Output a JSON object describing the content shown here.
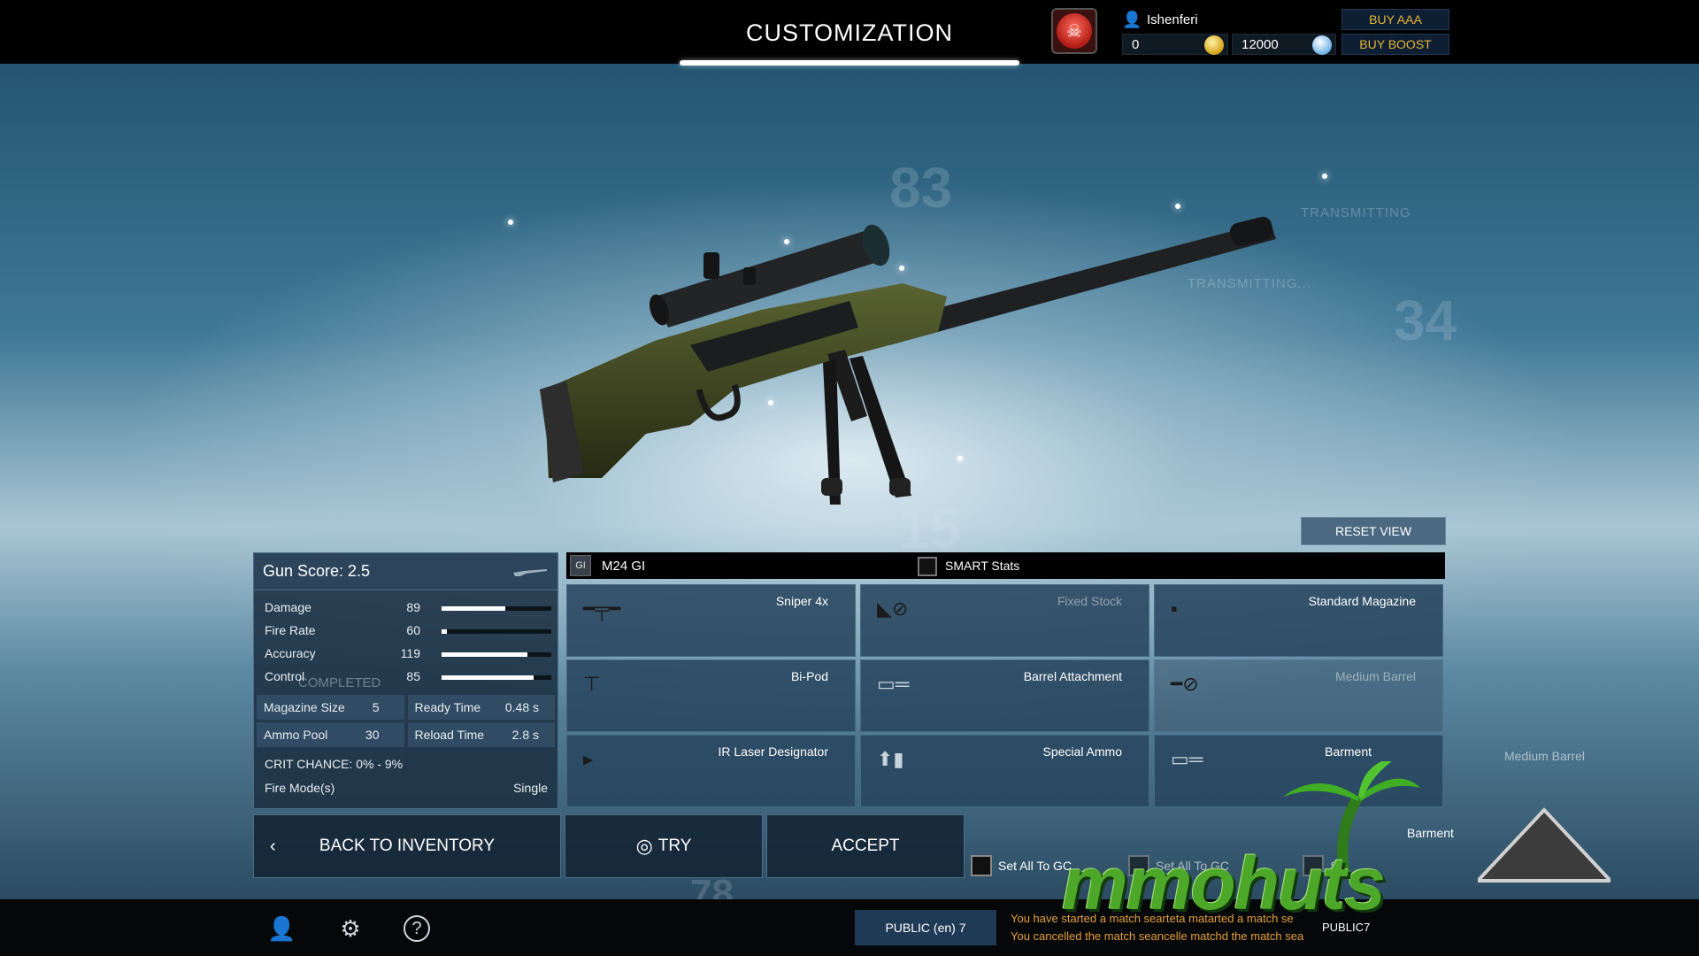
{
  "header": {
    "title": "CUSTOMIZATION",
    "username": "Ishenferi",
    "gold": "0",
    "cash": "12000",
    "buy_aaa": "BUY AAA",
    "buy_boost": "BUY BOOST"
  },
  "background": {
    "numbers": [
      "83",
      "34",
      "15",
      "78"
    ],
    "transmitting": [
      "TRANSMITTING",
      "TRANSMITTING..."
    ]
  },
  "reset_view": "RESET VIEW",
  "stats": {
    "gun_score": "Gun Score: 2.5",
    "rows": [
      {
        "label": "Damage",
        "value": "89",
        "fill": 0.58
      },
      {
        "label": "Fire Rate",
        "value": "60",
        "fill": 0.05
      },
      {
        "label": "Accuracy",
        "value": "119",
        "fill": 0.78
      },
      {
        "label": "Control",
        "value": "85",
        "fill": 0.84
      }
    ],
    "completed": "COMPLETED",
    "magazine_size": {
      "label": "Magazine Size",
      "value": "5"
    },
    "ready_time": {
      "label": "Ready Time",
      "value": "0.48 s"
    },
    "ammo_pool": {
      "label": "Ammo Pool",
      "value": "30"
    },
    "reload_time": {
      "label": "Reload Time",
      "value": "2.8 s"
    },
    "crit_chance": "CRIT CHANCE: 0% - 9%",
    "fire_modes_label": "Fire Mode(s)",
    "fire_modes_value": "Single"
  },
  "weapon": {
    "badge": "GI",
    "name": "M24 GI",
    "smart_stats": "SMART Stats"
  },
  "attachments": [
    {
      "label": "Sniper 4x",
      "icon": "scope-icon"
    },
    {
      "label": "Fixed Stock",
      "icon": "stock-icon"
    },
    {
      "label": "Standard Magazine",
      "icon": "magazine-icon"
    },
    {
      "label": "Bi-Pod",
      "icon": "bipod-icon"
    },
    {
      "label": "Barrel Attachment",
      "icon": "barrel-attachment-icon"
    },
    {
      "label": "Medium Barrel",
      "icon": "barrel-icon"
    },
    {
      "label": "IR Laser Designator",
      "icon": "laser-icon"
    },
    {
      "label": "Special Ammo",
      "icon": "ammo-icon"
    },
    {
      "label": "Barment",
      "icon": "barrel-attachment-icon"
    }
  ],
  "ghost_labels": {
    "medium_barrel": "Medium Barrel",
    "barment": "Barment"
  },
  "buttons": {
    "back": "BACK TO INVENTORY",
    "try": "TRY",
    "accept": "ACCEPT",
    "set_all_gc": "Set All To GC",
    "set_all_gc_2": "Set All To GC",
    "set_all_gc_3": "S"
  },
  "footer": {
    "lobby": "PUBLIC (en) 7",
    "lobby_ghost": "PUBLIC7",
    "chat": [
      "You have started a match searteta matarted a match se",
      "You cancelled the match seancelle matchd the match sea"
    ]
  },
  "watermark": "mmohuts",
  "colors": {
    "accent_gold": "#e6b534",
    "chat_orange": "#e6a03a",
    "panel": "#1c3042"
  }
}
